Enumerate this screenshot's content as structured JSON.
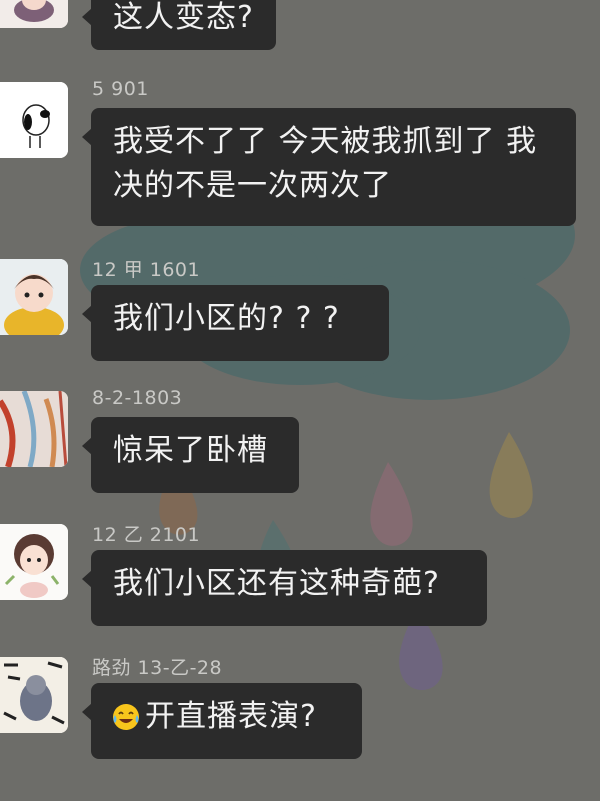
{
  "messages": [
    {
      "id": "m0",
      "sender": "",
      "text": "这人变态?",
      "avatar_icon": "anime-avatar-icon"
    },
    {
      "id": "m1",
      "sender": "5 901",
      "text": "我受不了了 今天被我抓到了 我决的不是一次两次了",
      "line1": "我受不了了 今天被我抓到了 我",
      "line2": "决的不是一次两次了",
      "avatar_icon": "snoopy-avatar-icon"
    },
    {
      "id": "m2",
      "sender": "12 甲 1601",
      "text": "我们小区的? ? ?",
      "avatar_icon": "child-avatar-icon"
    },
    {
      "id": "m3",
      "sender": "8-2-1803",
      "text": "惊呆了卧槽",
      "avatar_icon": "photo-avatar-icon"
    },
    {
      "id": "m4",
      "sender": "12 乙 2101",
      "text": "我们小区还有这种奇葩?",
      "avatar_icon": "cartoon-girl-avatar-icon"
    },
    {
      "id": "m5",
      "sender": "路劲 13-乙-28",
      "text": "开直播表演?",
      "emoji": "crying-laughing-emoji",
      "avatar_icon": "calligraphy-avatar-icon"
    }
  ],
  "colors": {
    "background": "#6d6d69",
    "bubble": "#2b2b2b",
    "bubble_text": "#f2f2f2",
    "sender_text": "#c9c9c6"
  }
}
